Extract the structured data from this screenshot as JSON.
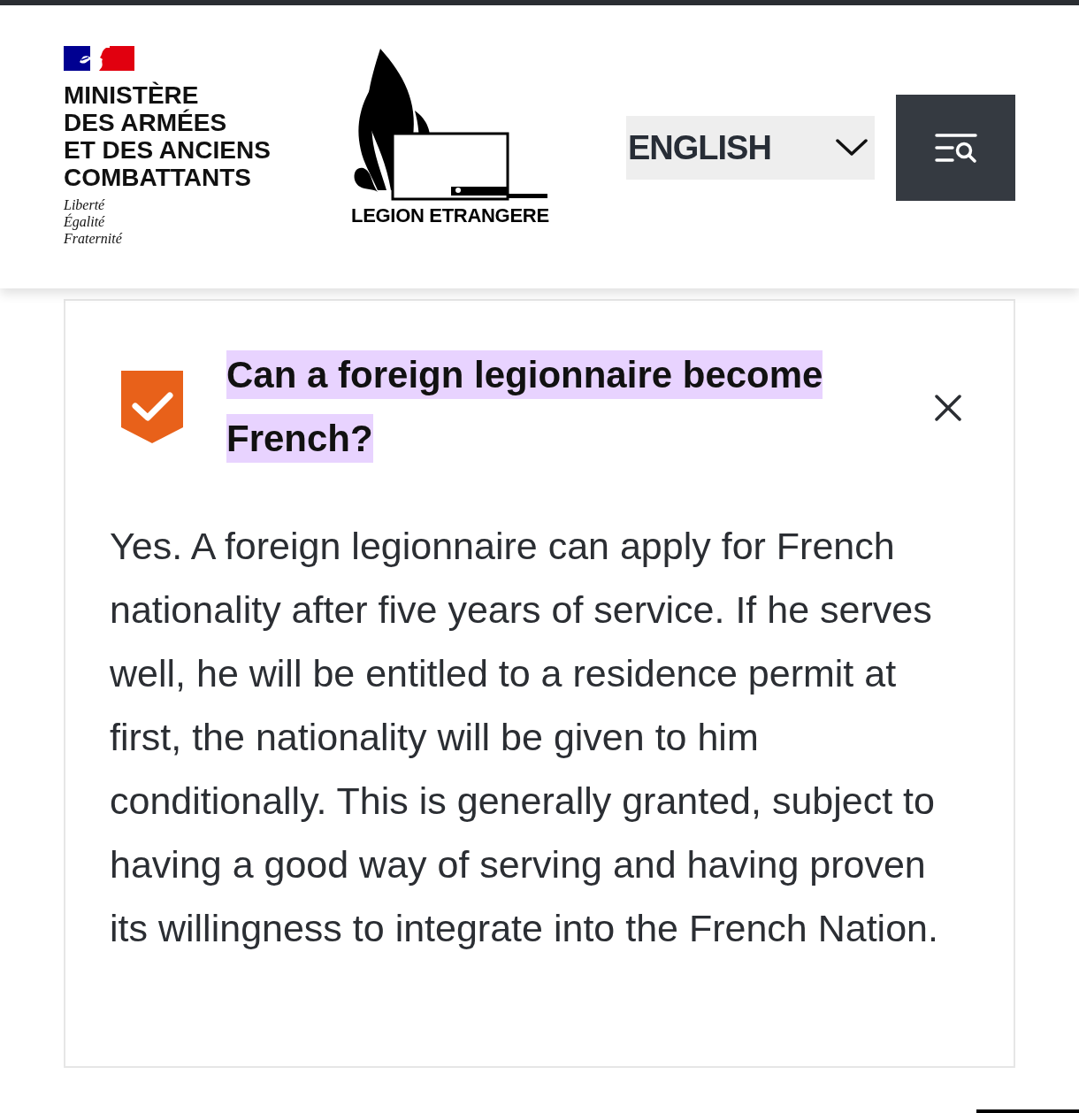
{
  "header": {
    "ministry": {
      "name_lines": [
        "MINISTÈRE",
        "DES ARMÉES",
        "ET DES ANCIENS",
        "COMBATTANTS"
      ],
      "motto_lines": [
        "Liberté",
        "Égalité",
        "Fraternité"
      ]
    },
    "legion_logo": {
      "text": "LEGION ETRANGERE"
    },
    "language_select": {
      "value": "ENGLISH"
    }
  },
  "faq_item": {
    "question": "Can a foreign legionnaire become French?",
    "highlighted": true,
    "expanded": true,
    "answer": "Yes. A foreign legionnaire can apply for French nationality after five years of service. If he serves well, he will be entitled to a residence permit at first, the nationality will be given to him conditionally. This is generally granted, subject to having a good way of serving and having proven its willingness to integrate into the French Nation."
  }
}
